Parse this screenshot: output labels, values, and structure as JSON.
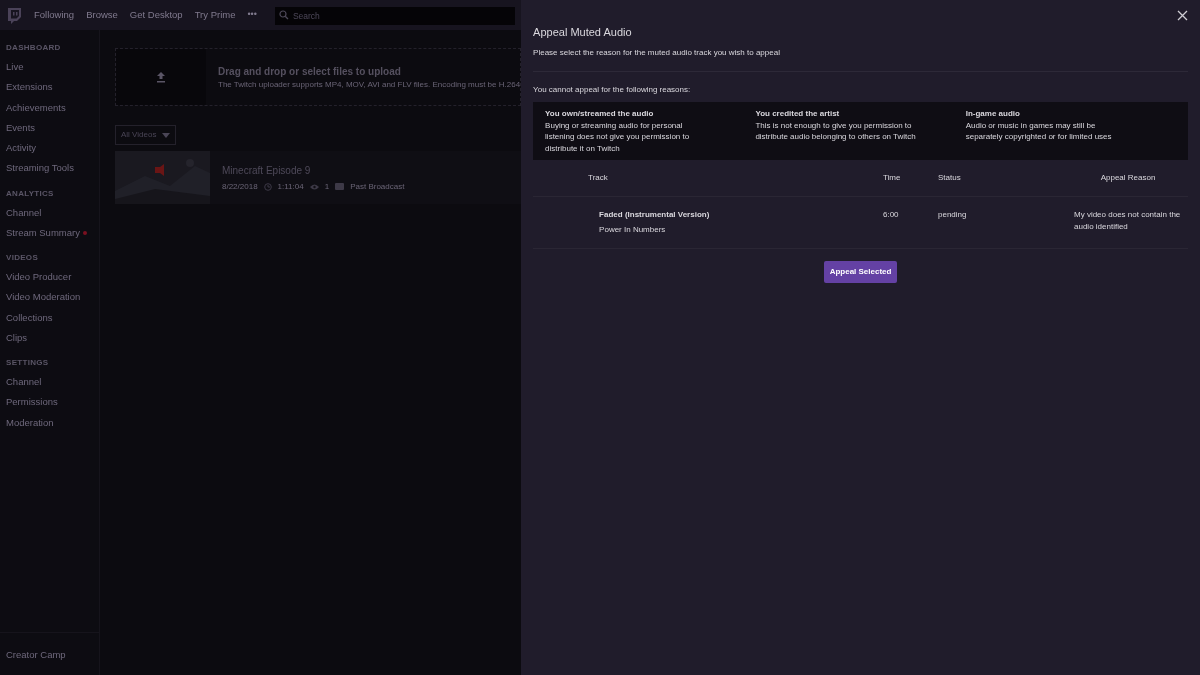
{
  "topnav": {
    "links": [
      "Following",
      "Browse",
      "Get Desktop",
      "Try Prime"
    ],
    "more": "•••",
    "search": {
      "placeholder": "Search"
    }
  },
  "sidebar": {
    "sections": [
      {
        "heading": "DASHBOARD",
        "items": [
          {
            "label": "Live",
            "notification": false
          },
          {
            "label": "Extensions",
            "notification": false
          },
          {
            "label": "Achievements",
            "notification": false
          },
          {
            "label": "Events",
            "notification": false
          },
          {
            "label": "Activity",
            "notification": false
          },
          {
            "label": "Streaming Tools",
            "notification": false
          }
        ]
      },
      {
        "heading": "ANALYTICS",
        "items": [
          {
            "label": "Channel",
            "notification": false
          },
          {
            "label": "Stream Summary",
            "notification": true
          }
        ]
      },
      {
        "heading": "VIDEOS",
        "items": [
          {
            "label": "Video Producer",
            "notification": false
          },
          {
            "label": "Video Moderation",
            "notification": false
          },
          {
            "label": "Collections",
            "notification": false
          },
          {
            "label": "Clips",
            "notification": false
          }
        ]
      },
      {
        "heading": "SETTINGS",
        "items": [
          {
            "label": "Channel",
            "notification": false
          },
          {
            "label": "Permissions",
            "notification": false
          },
          {
            "label": "Moderation",
            "notification": false
          }
        ]
      }
    ],
    "footer": "Creator Camp"
  },
  "upload": {
    "title": "Drag and drop or select files to upload",
    "subtitle": "The Twitch uploader supports MP4, MOV, AVI and FLV files. Encoding must be H.264"
  },
  "filter": "All Videos",
  "videos": [
    {
      "title": "Minecraft Episode 9",
      "date": "8/22/2018",
      "duration": "1:11:04",
      "views": "1",
      "type": "Past Broadcast"
    }
  ],
  "modal": {
    "title": "Appeal Muted Audio",
    "instruction": "Please select the reason for the muted audio track you wish to appeal",
    "cannot_label": "You cannot appeal for the following reasons:",
    "reasons": [
      {
        "title": "You own/streamed the audio",
        "text": "Buying or streaming audio for personal listening does not give you permission to distribute it on Twitch"
      },
      {
        "title": "You credited the artist",
        "text": "This is not enough to give you permission to distribute audio belonging to others on Twitch"
      },
      {
        "title": "In-game audio",
        "text": "Audio or music in games may still be separately copyrighted or for limited uses"
      }
    ],
    "table": {
      "columns": [
        "Track",
        "Time",
        "Status",
        "Appeal Reason"
      ],
      "rows": [
        {
          "track": "Faded (Instrumental Version)",
          "artist": "Power In Numbers",
          "time": "6:00",
          "status": "pending",
          "reason": "My video does not contain the audio identified"
        }
      ]
    },
    "button": "Appeal Selected"
  }
}
